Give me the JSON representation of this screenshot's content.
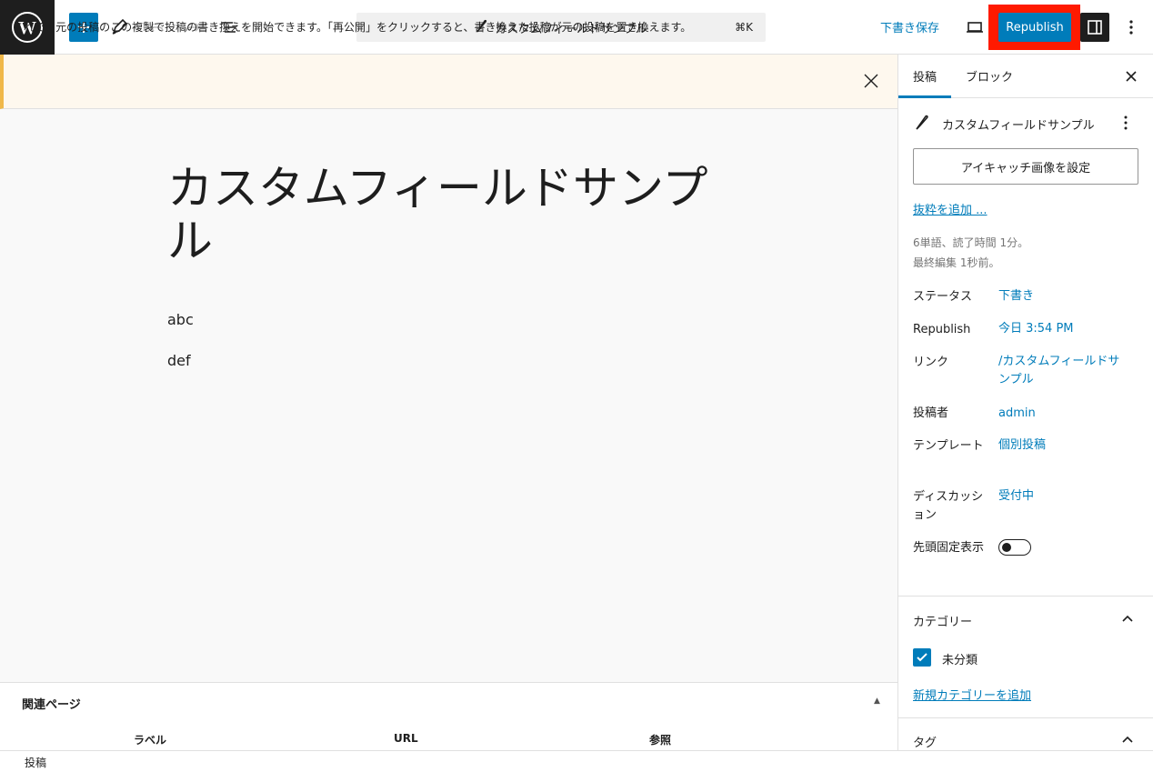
{
  "toolbar": {
    "doc_title": "カスタムフィールドサンプル",
    "shortcut": "⌘K",
    "save_draft": "下書き保存",
    "republish": "Republish"
  },
  "notice": {
    "text": "これで、元の投稿のこの複製で投稿の書き換えを開始できます。「再公開」をクリックすると、書き換えた投稿が元の投稿を置き換えます。"
  },
  "editor": {
    "title": "カスタムフィールドサンプル",
    "paragraphs": [
      "abc",
      "def"
    ]
  },
  "metabox": {
    "title": "関連ページ",
    "columns": [
      "ラベル",
      "URL",
      "参照"
    ]
  },
  "footer": {
    "breadcrumb": "投稿"
  },
  "sidebar": {
    "tabs": [
      "投稿",
      "ブロック"
    ],
    "post_name": "カスタムフィールドサンプル",
    "featured_image": "アイキャッチ画像を設定",
    "excerpt": "抜粋を追加 ...",
    "stats_line1": "6単語、読了時間 1分。",
    "stats_line2": "最終編集 1秒前。",
    "rows": [
      {
        "label": "ステータス",
        "value": "下書き"
      },
      {
        "label": "Republish",
        "value": "今日 3:54 PM"
      },
      {
        "label": "リンク",
        "value": "/カスタムフィールドサンプル"
      },
      {
        "label": "投稿者",
        "value": "admin"
      },
      {
        "label": "テンプレート",
        "value": "個別投稿"
      },
      {
        "label": "ディスカッション",
        "value": "受付中"
      },
      {
        "label": "先頭固定表示",
        "value": ""
      }
    ],
    "category_panel": "カテゴリー",
    "category_item": "未分類",
    "add_category": "新規カテゴリーを追加",
    "tag_panel": "タグ"
  },
  "colors": {
    "accent": "#007cba",
    "highlight": "#ff1a00",
    "notice_border": "#f0b849"
  }
}
